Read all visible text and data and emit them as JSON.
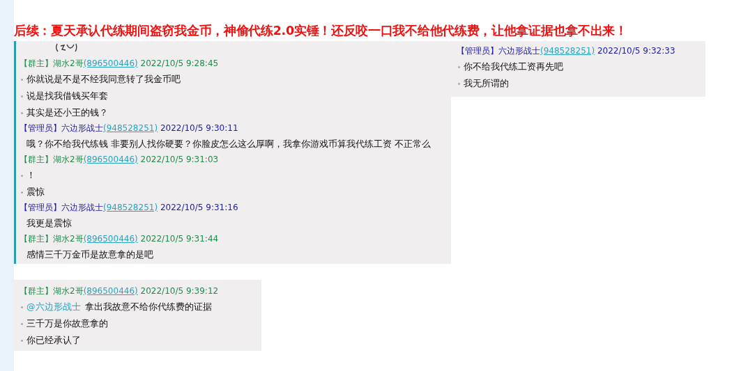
{
  "headline": "后续：夏天承认代练期间盗窃我金币，神偷代练2.0实锤！还反咬一口我不给他代练费，让他拿证据也拿不出来！",
  "panels": [
    {
      "sticker": true,
      "messages": [
        {
          "kind": "owner",
          "role": "【群主】",
          "name": "湖水2哥",
          "qq": "(896500446)",
          "time": "2022/10/5 9:28:45",
          "lines": [
            {
              "bullet": true,
              "text": "你就说是不是不经我同意转了我金币吧"
            },
            {
              "bullet": true,
              "text": "说是找我借钱买年套"
            },
            {
              "bullet": true,
              "text": "其实是还小王的钱？"
            }
          ]
        },
        {
          "kind": "admin",
          "role": "【管理员】",
          "name": "六边形战士",
          "qq": "(948528251)",
          "time": "2022/10/5 9:30:11",
          "lines": [
            {
              "bullet": false,
              "text": "哦？你不给我代练钱 非要别人找你硬要？你脸皮怎么这么厚啊，我拿你游戏币算我代练工资 不正常么"
            }
          ]
        },
        {
          "kind": "owner",
          "role": "【群主】",
          "name": "湖水2哥",
          "qq": "(896500446)",
          "time": "2022/10/5 9:31:03",
          "lines": [
            {
              "bullet": true,
              "text": "！"
            },
            {
              "bullet": true,
              "text": "震惊"
            }
          ]
        },
        {
          "kind": "admin",
          "role": "【管理员】",
          "name": "六边形战士",
          "qq": "(948528251)",
          "time": "2022/10/5 9:31:16",
          "lines": [
            {
              "bullet": false,
              "text": "我更是震惊"
            }
          ]
        },
        {
          "kind": "owner",
          "role": "【群主】",
          "name": "湖水2哥",
          "qq": "(896500446)",
          "time": "2022/10/5 9:31:44",
          "lines": [
            {
              "bullet": false,
              "text": "感情三千万金币是故意拿的是吧"
            }
          ]
        }
      ]
    },
    {
      "sticker": false,
      "messages": [
        {
          "kind": "admin",
          "role": "【管理员】",
          "name": "六边形战士",
          "qq": "(948528251)",
          "time": "2022/10/5 9:32:33",
          "lines": [
            {
              "bullet": true,
              "text": "你不给我代练工资再先吧"
            },
            {
              "bullet": true,
              "text": "我无所谓的"
            }
          ]
        }
      ]
    },
    {
      "sticker": false,
      "messages": [
        {
          "kind": "owner",
          "role": "【群主】",
          "name": "湖水2哥",
          "qq": "(896500446)",
          "time": "2022/10/5 9:39:12",
          "lines": [
            {
              "bullet": true,
              "mention": "@六边形战士",
              "text": "拿出我故意不给你代练费的证据"
            },
            {
              "bullet": true,
              "text": "三千万是你故意拿的"
            },
            {
              "bullet": true,
              "text": "你已经承认了"
            }
          ]
        }
      ]
    }
  ]
}
